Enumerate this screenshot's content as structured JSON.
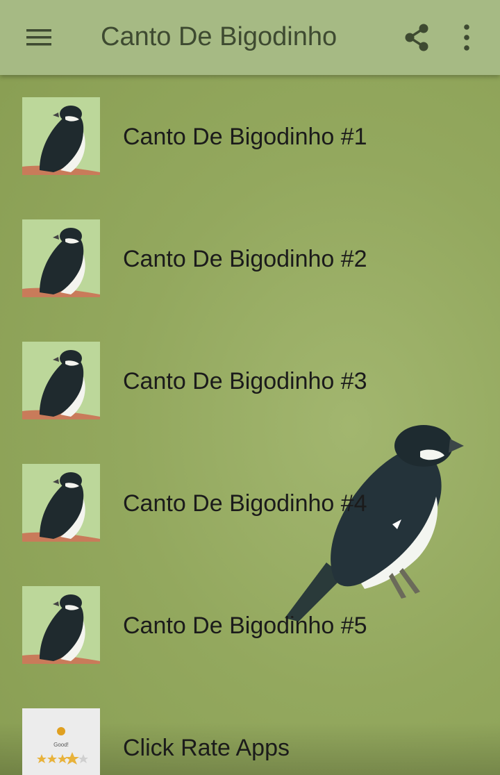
{
  "toolbar": {
    "title": "Canto De Bigodinho",
    "menu_icon": "hamburger-menu-icon",
    "share_icon": "share-icon",
    "more_icon": "more-vert-icon",
    "background": "#a6ba84"
  },
  "list": {
    "items": [
      {
        "label": "Canto De Bigodinho #1",
        "icon": "bird-thumbnail"
      },
      {
        "label": "Canto De Bigodinho #2",
        "icon": "bird-thumbnail"
      },
      {
        "label": "Canto De Bigodinho #3",
        "icon": "bird-thumbnail"
      },
      {
        "label": "Canto De Bigodinho #4",
        "icon": "bird-thumbnail"
      },
      {
        "label": "Canto De Bigodinho #5",
        "icon": "bird-thumbnail"
      }
    ],
    "rate_item": {
      "label": "Click Rate Apps",
      "icon": "rate-apps-icon",
      "badge_text": "Good!"
    }
  },
  "colors": {
    "background": "#8fa55a",
    "text": "#1b1b1b",
    "title": "#3e4a31"
  }
}
